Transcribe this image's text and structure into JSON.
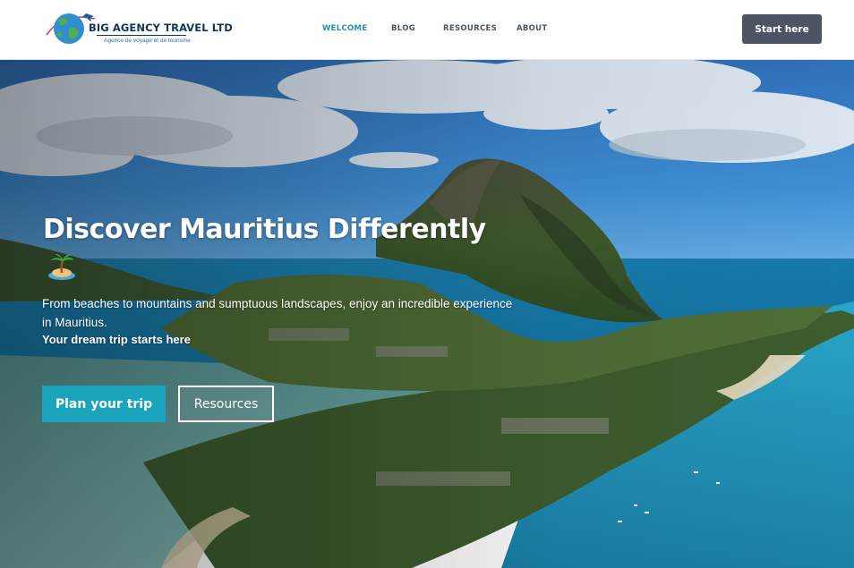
{
  "brand": {
    "name": "BIG AGENCY TRAVEL LTD",
    "tagline": "Agence de voyage et de tourisme",
    "logo_icon": "globe-plane-icon"
  },
  "nav": {
    "items": [
      {
        "label": "WELCOME",
        "active": true
      },
      {
        "label": "BLOG",
        "active": false
      },
      {
        "label": "RESOURCES",
        "active": false
      },
      {
        "label": "ABOUT",
        "active": false
      }
    ],
    "start_label": "Start here"
  },
  "hero": {
    "title": "Discover Mauritius Differently",
    "emoji_icon": "desert-island-icon",
    "description": "From beaches to mountains and sumptuous landscapes, enjoy an incredible experience in Mauritius.",
    "cta_text": "Your dream trip starts here",
    "primary_button": "Plan your trip",
    "secondary_button": "Resources"
  },
  "colors": {
    "accent": "#1aa4bc",
    "nav_active": "#2a8ca6",
    "header_button": "#4b5563",
    "brand_text": "#12355b"
  }
}
